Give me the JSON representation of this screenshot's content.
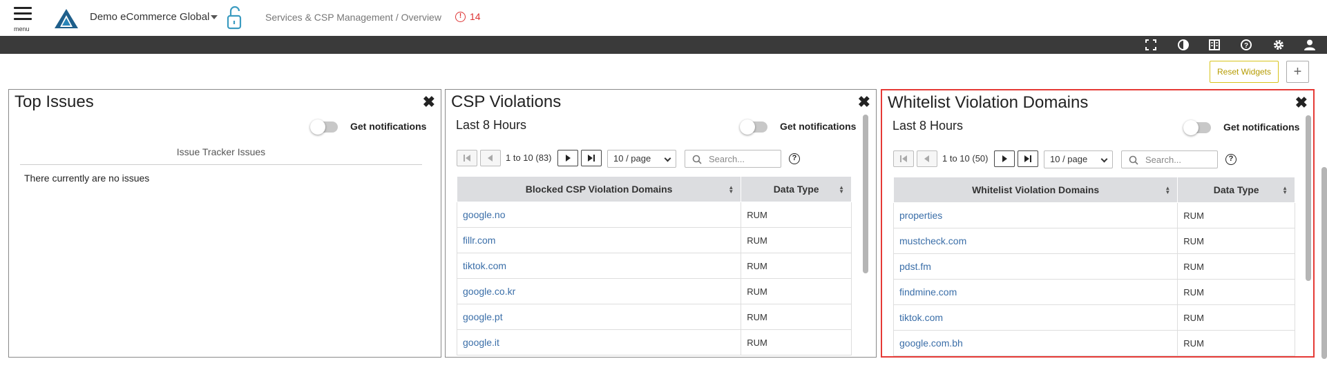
{
  "header": {
    "menu_label": "menu",
    "org_name": "Demo eCommerce Global",
    "breadcrumb": "Services & CSP Management / Overview",
    "alert_count": "14"
  },
  "toolbar": {
    "icons": [
      "fullscreen-icon",
      "contrast-icon",
      "book-icon",
      "help-icon",
      "gear-icon",
      "user-icon"
    ]
  },
  "widgets_bar": {
    "reset_label": "Reset Widgets",
    "add_label": "+"
  },
  "panels": {
    "top_issues": {
      "title": "Top Issues",
      "notif_label": "Get notifications",
      "list_header": "Issue Tracker Issues",
      "empty_text": "There currently are no issues"
    },
    "csp": {
      "title": "CSP Violations",
      "subtitle": "Last 8 Hours",
      "notif_label": "Get notifications",
      "pager_text": "1 to 10 (83)",
      "page_size": "10 / page",
      "search_placeholder": "Search...",
      "columns": [
        "Blocked CSP Violation Domains",
        "Data Type"
      ],
      "rows": [
        {
          "domain": "google.no",
          "type": "RUM"
        },
        {
          "domain": "fillr.com",
          "type": "RUM"
        },
        {
          "domain": "tiktok.com",
          "type": "RUM"
        },
        {
          "domain": "google.co.kr",
          "type": "RUM"
        },
        {
          "domain": "google.pt",
          "type": "RUM"
        },
        {
          "domain": "google.it",
          "type": "RUM"
        }
      ]
    },
    "whitelist": {
      "title": "Whitelist Violation Domains",
      "subtitle": "Last 8 Hours",
      "notif_label": "Get notifications",
      "pager_text": "1 to 10 (50)",
      "page_size": "10 / page",
      "search_placeholder": "Search...",
      "columns": [
        "Whitelist Violation Domains",
        "Data Type"
      ],
      "rows": [
        {
          "domain": "properties",
          "type": "RUM"
        },
        {
          "domain": "mustcheck.com",
          "type": "RUM"
        },
        {
          "domain": "pdst.fm",
          "type": "RUM"
        },
        {
          "domain": "findmine.com",
          "type": "RUM"
        },
        {
          "domain": "tiktok.com",
          "type": "RUM"
        },
        {
          "domain": "google.com.bh",
          "type": "RUM"
        }
      ]
    }
  },
  "colors": {
    "toolbar_bg": "#3a3a3a",
    "link": "#3a6ea8",
    "alert": "#dd3333",
    "highlight": "#e53935",
    "reset_accent": "#d7c31a"
  }
}
